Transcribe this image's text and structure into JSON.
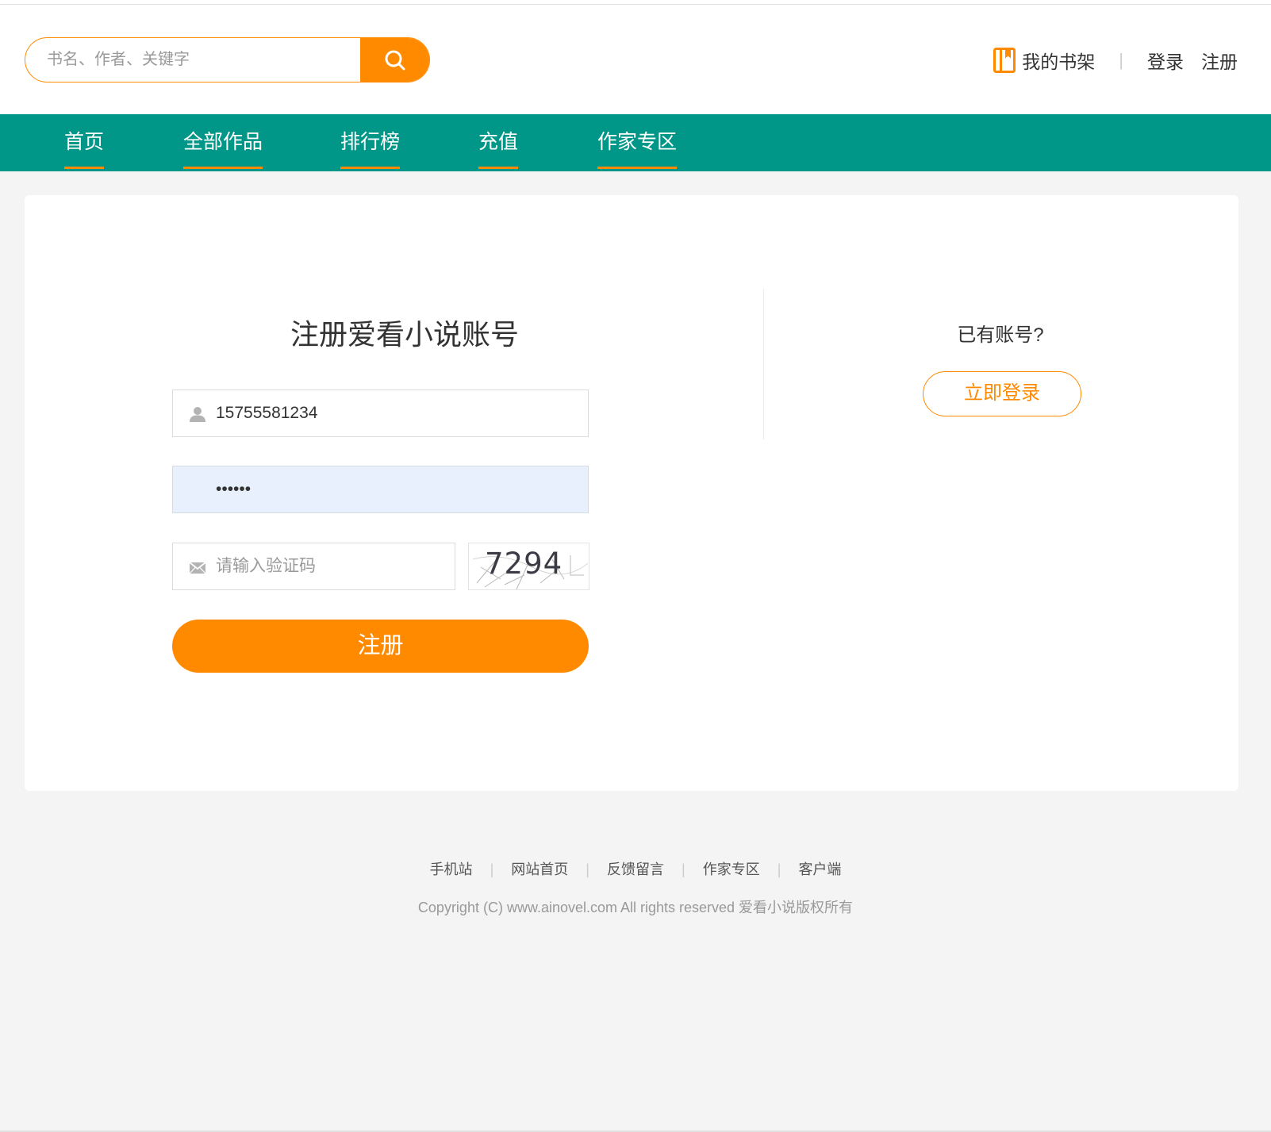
{
  "header": {
    "search_placeholder": "书名、作者、关键字",
    "search_icon": "search-icon",
    "shelf_label": "我的书架",
    "shelf_icon": "bookshelf-icon",
    "separator": "|",
    "login_label": "登录",
    "register_label": "注册"
  },
  "nav": {
    "items": [
      {
        "label": "首页"
      },
      {
        "label": "全部作品"
      },
      {
        "label": "排行榜"
      },
      {
        "label": "充值"
      },
      {
        "label": "作家专区"
      }
    ]
  },
  "form": {
    "title": "注册爱看小说账号",
    "phone_value": "15755581234",
    "password_value": "123456",
    "captcha_placeholder": "请输入验证码",
    "captcha_code": "7294",
    "submit_label": "注册"
  },
  "side": {
    "have_account": "已有账号?",
    "login_now": "立即登录"
  },
  "footer": {
    "links": [
      "手机站",
      "网站首页",
      "反馈留言",
      "作家专区",
      "客户端"
    ],
    "separator": "|",
    "copyright": "Copyright (C) www.ainovel.com All rights reserved  爱看小说版权所有"
  },
  "colors": {
    "accent": "#ff8a00",
    "nav_bg": "#019788",
    "page_bg": "#f4f4f4",
    "autofill_bg": "#e8f0fe"
  }
}
